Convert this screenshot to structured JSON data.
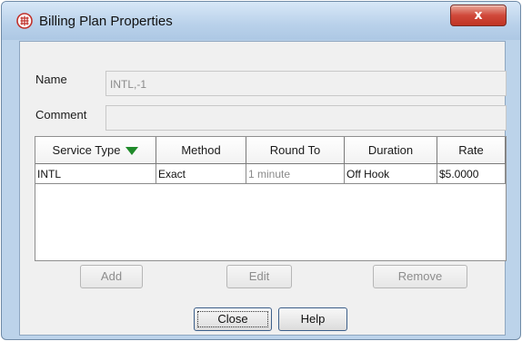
{
  "window": {
    "title": "Billing Plan Properties",
    "close_glyph": "x"
  },
  "form": {
    "name_label": "Name",
    "name_value": "INTL,-1",
    "comment_label": "Comment",
    "comment_value": ""
  },
  "table": {
    "columns": [
      "Service Type",
      "Method",
      "Round To",
      "Duration",
      "Rate"
    ],
    "sort_column": "Service Type",
    "sort_direction": "descending",
    "rows": [
      {
        "service_type": "INTL",
        "method": "Exact",
        "round_to": "1 minute",
        "duration": "Off Hook",
        "rate": "$5.0000"
      }
    ]
  },
  "actions": {
    "add": "Add",
    "edit": "Edit",
    "remove": "Remove"
  },
  "footer": {
    "close": "Close",
    "help": "Help"
  },
  "colors": {
    "title_gradient": "#b9d1ea",
    "close_button": "#c03424",
    "sort_arrow": "#1f8a2a"
  }
}
